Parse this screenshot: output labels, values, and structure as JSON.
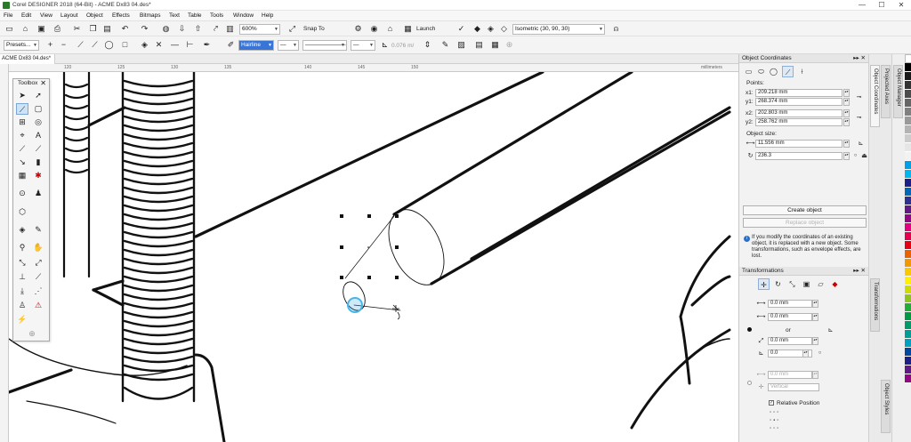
{
  "window": {
    "title": "Corel DESIGNER 2018 (64-Bit) - ACME Dx83 04.des*",
    "buttons": {
      "minimize": "—",
      "maximize": "☐",
      "close": "✕"
    }
  },
  "menu": [
    "File",
    "Edit",
    "View",
    "Layout",
    "Object",
    "Effects",
    "Bitmaps",
    "Text",
    "Table",
    "Tools",
    "Window",
    "Help"
  ],
  "toolbar1": {
    "zoom": "600%",
    "snap_to": "Snap To",
    "launch": "Launch",
    "projection": "Isometric (30, 90, 30)"
  },
  "toolbar2": {
    "presets": "Presets...",
    "outline_width": "Hairline",
    "angle_value": "0.076 m/"
  },
  "document": {
    "tab": "ACME Dx83 04.des*",
    "ruler_unit": "millimeters",
    "ruler_ticks": [
      "120",
      "125",
      "130",
      "135",
      "140",
      "145",
      "150"
    ]
  },
  "toolbox": {
    "title": "Toolbox"
  },
  "object_coordinates": {
    "title": "Object Coordinates",
    "points_label": "Points:",
    "points": [
      {
        "xl": "x1:",
        "x": "209.218 mm",
        "yl": "y1:",
        "y": "268.374 mm"
      },
      {
        "xl": "x2:",
        "x": "202.803 mm",
        "yl": "y2:",
        "y": "258.762 mm"
      }
    ],
    "size_label": "Object size:",
    "size_value": "11.556 mm",
    "angle_value": "236.3",
    "create_button": "Create object",
    "replace_button": "Replace object",
    "info": "If you modify the coordinates of an existing object, it is replaced with a new object.  Some transformations, such as envelope effects, are lost."
  },
  "transformations": {
    "title": "Transformations",
    "h_value": "0.0 mm",
    "v_value": "0.0 mm",
    "or_label": "or",
    "dist_value": "0.0 mm",
    "angle_value": "0.0",
    "x_value": "0.0 mm",
    "anchor_value": "Vertical",
    "relative_position": "Relative Position"
  },
  "side_tabs": [
    "Object Coordinates",
    "Projected Axes",
    "Transformations",
    "Object Styles",
    "Object Manager"
  ],
  "palette_colors": [
    "#ffffff",
    "#000000",
    "#1a1a1a",
    "#333333",
    "#4d4d4d",
    "#666666",
    "#808080",
    "#999999",
    "#b3b3b3",
    "#cccccc",
    "#e6e6e6",
    "#f2f2f2",
    "#00a0e9",
    "#00b7ee",
    "#1d2088",
    "#0068b7",
    "#2e3192",
    "#601986",
    "#920783",
    "#e4007f",
    "#e5004f",
    "#e60012",
    "#eb6100",
    "#f39800",
    "#fcc800",
    "#fff100",
    "#cfdb00",
    "#8fc31f",
    "#22ac38",
    "#009944",
    "#009b6b",
    "#009e96",
    "#00a0c1",
    "#00479d",
    "#1d2088",
    "#601986",
    "#920783"
  ]
}
